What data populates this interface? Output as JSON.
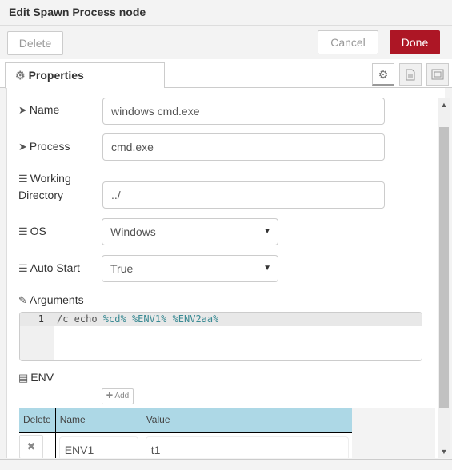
{
  "header": {
    "title": "Edit Spawn Process node"
  },
  "buttons": {
    "delete": "Delete",
    "cancel": "Cancel",
    "done": "Done"
  },
  "tabs": {
    "properties": {
      "label": "Properties",
      "icon": "gear-icon"
    },
    "side_icons": [
      {
        "name": "settings-tab-icon",
        "glyph": "⚙"
      },
      {
        "name": "description-tab-icon",
        "glyph": "🖹"
      },
      {
        "name": "appearance-tab-icon",
        "glyph": "⧉"
      }
    ]
  },
  "form": {
    "name": {
      "label": "Name",
      "value": "windows cmd.exe",
      "icon": "tag-icon"
    },
    "process": {
      "label": "Process",
      "value": "cmd.exe",
      "icon": "tag-icon"
    },
    "working_directory": {
      "label_line1": "Working",
      "label_line2": "Directory",
      "value": "../",
      "icon": "list-icon"
    },
    "os": {
      "label": "OS",
      "value": "Windows",
      "icon": "list-icon"
    },
    "auto_start": {
      "label": "Auto Start",
      "value": "True",
      "icon": "list-icon"
    },
    "arguments": {
      "label": "Arguments",
      "icon": "edit-icon",
      "line_number": "1",
      "tokens": [
        "/c echo ",
        "%",
        "cd",
        "% ",
        "%",
        "ENV1",
        "% ",
        "%",
        "ENV2aa",
        "%"
      ]
    },
    "env": {
      "label": "ENV",
      "icon": "table-icon",
      "add_label": "Add",
      "columns": [
        "Delete",
        "Name",
        "Value"
      ],
      "rows": [
        {
          "name": "ENV1",
          "value": "t1"
        }
      ]
    }
  },
  "colors": {
    "done_button": "#ad1625",
    "table_header": "#add8e6",
    "code_variable": "#3a8a93"
  }
}
